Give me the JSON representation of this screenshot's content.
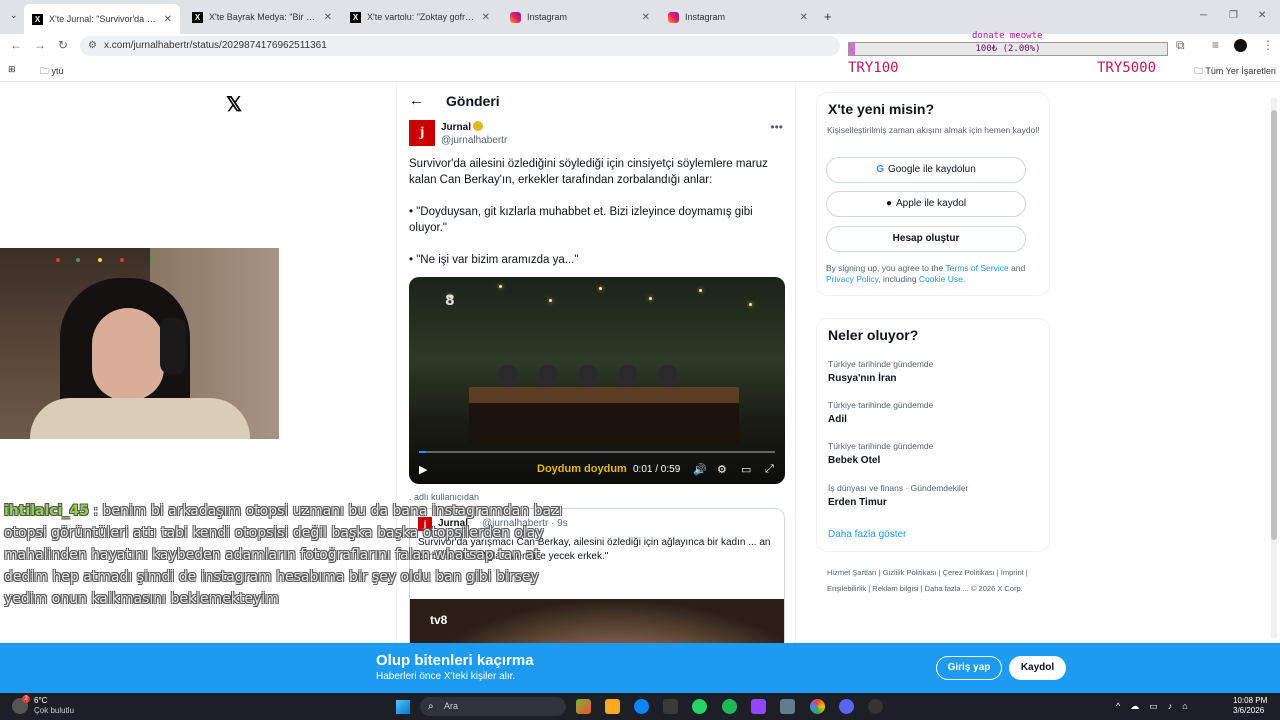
{
  "browser": {
    "tabs": [
      {
        "title": "X'te Jurnal: \"Survivor'da ailesini",
        "icon": "x-icon"
      },
      {
        "title": "X'te Bayrak Medya: \"Bir kadın,",
        "icon": "x-icon"
      },
      {
        "title": "X'te vartolu: \"Zoktay gofret rek",
        "icon": "x-icon"
      },
      {
        "title": "Instagram",
        "icon": "instagram-icon"
      },
      {
        "title": "Instagram",
        "icon": "instagram-icon"
      }
    ],
    "url": "x.com/jurnalhabertr/status/2029874176962511361",
    "bookmark_folder": "ytü",
    "all_bookmarks": "Tüm Yer İşaretleri"
  },
  "donation": {
    "label": "donate meowte",
    "amount": "100₺ (2.00%)",
    "progress_percent": 2,
    "min": "TRY100",
    "max": "TRY5000"
  },
  "page": {
    "title": "Gönderi",
    "author": {
      "name": "Jurnal",
      "handle": "@jurnalhabertr",
      "avatar_letter": "j"
    },
    "post_paragraphs": [
      "Survivor'da ailesini özlediğini söylediği için cinsiyetçi söylemlere maruz kalan Can Berkay'ın, erkekler tarafından zorbalandığı anlar:",
      "• \"Doyduysan, git kızlarla muhabbet et. Bizi izleyince doymamış gibi oluyor.\"",
      "• \"Ne işi var bizim aramızda ya...\""
    ],
    "video": {
      "logo": "8",
      "time": "0:01 / 0:59",
      "progress_fraction": 0.02,
      "caption": "Doydum doydum"
    },
    "embed_context": ". adlı kullanıcıdan",
    "quote": {
      "name": "Jurnal",
      "handle": "@jurnalhabertr · 9s",
      "body": "Survivor'da yarışmacı Can Berkay, ailesini özlediği için ağlayınca bir kadın ... an zorbalandı: ... Ağla evlenince yecek erkek.\"",
      "image_logo": "tv8"
    }
  },
  "sidebar": {
    "signup": {
      "title": "X'te yeni misin?",
      "desc": "Kişiselleştirilmiş zaman akışını almak için hemen kaydol!",
      "google": "Google ile kaydolun",
      "apple": "Apple ile kaydol",
      "create": "Hesap oluştur",
      "legal_pre": "By signing up, you agree to the ",
      "tos": "Terms of Service",
      "and": " and ",
      "privacy": "Privacy Policy",
      "including": ", including ",
      "cookie": "Cookie Use",
      "end": "."
    },
    "trends": {
      "title": "Neler oluyor?",
      "items": [
        {
          "context": "Türkiye tarihinde gündemde",
          "name": "Rusya'nın İran"
        },
        {
          "context": "Türkiye tarihinde gündemde",
          "name": "Adil"
        },
        {
          "context": "Türkiye tarihinde gündemde",
          "name": "Bebek Otel"
        },
        {
          "context": "İş dünyası ve finans · Gündemdekiler",
          "name": "Erden Timur"
        }
      ],
      "show_more": "Daha fazla göster"
    },
    "footer": "Hizmet Şartları | Gizlilik Politikası | Çerez Politikası | Imprint | Erişilebilirlik | Reklam bilgisi | Daha fazla ... © 2026 X Corp."
  },
  "chat": {
    "user": "ihtilalci_45",
    "message": ": benim bi arkadaşım otopsi uzmanı bu da bana instagramdan bazı otopsi görüntüleri attı tabi kendi otopsisi değil başka başka otopsilerden olay mahalinden hayatını kaybeden adamların fotoğraflarını falan whatsap tan at dedim hep atmadı şimdi de instagram hesabıma bir şey oldu ban gibi birsey yedim onun kalkmasını beklemekteyim"
  },
  "banner": {
    "title": "Olup bitenleri kaçırma",
    "subtitle": "Haberleri önce X'teki kişiler alır.",
    "login": "Giriş yap",
    "signup": "Kaydol"
  },
  "taskbar": {
    "temp": "6°C",
    "weather": "Çok bulutlu",
    "weather_badge": "2",
    "search": "Ara",
    "time": "10:08 PM",
    "date": "3/6/2026"
  },
  "colors": {
    "x_blue": "#1d9bf0",
    "jurnal_red": "#cc0000",
    "donate_pink": "#d070d0"
  }
}
